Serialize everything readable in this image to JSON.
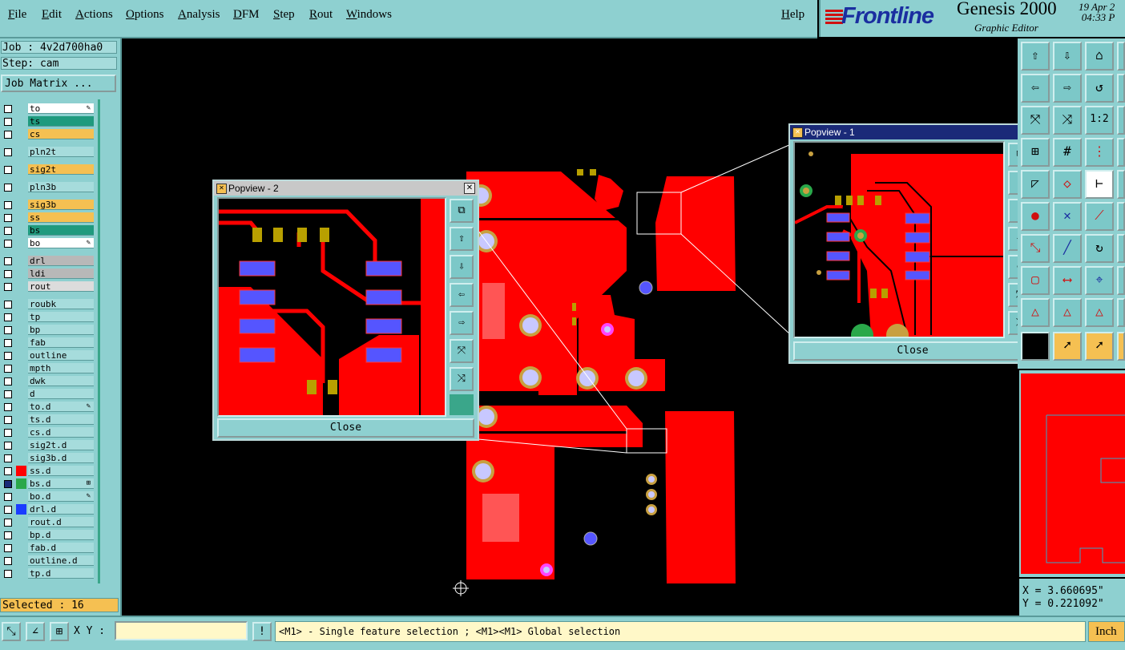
{
  "menu": {
    "items": [
      "File",
      "Edit",
      "Actions",
      "Options",
      "Analysis",
      "DFM",
      "Step",
      "Rout",
      "Windows"
    ],
    "help": "Help"
  },
  "brand": {
    "logo": "Frontline",
    "product": "Genesis 2000",
    "subtitle": "Graphic Editor",
    "date": "19 Apr 2",
    "time": "04:33 P"
  },
  "job": {
    "job_label": "Job : 4v2d700ha0",
    "step_label": "Step: cam",
    "matrix_button": "Job Matrix ..."
  },
  "layers": [
    {
      "name": "to",
      "color": "#ffffff",
      "flag": "✎",
      "checked": false,
      "swatch": ""
    },
    {
      "name": "ts",
      "color": "#1f9a7e",
      "flag": "",
      "checked": false,
      "swatch": ""
    },
    {
      "name": "cs",
      "color": "#f5c052",
      "flag": "",
      "checked": false,
      "swatch": ""
    },
    {
      "name": "pln2t",
      "color": "#a6dcdc",
      "flag": "",
      "checked": false,
      "swatch": ""
    },
    {
      "name": "sig2t",
      "color": "#f5c052",
      "flag": "",
      "checked": false,
      "swatch": ""
    },
    {
      "name": "pln3b",
      "color": "#a6dcdc",
      "flag": "",
      "checked": false,
      "swatch": ""
    },
    {
      "name": "sig3b",
      "color": "#f5c052",
      "flag": "",
      "checked": false,
      "swatch": ""
    },
    {
      "name": "ss",
      "color": "#f5c052",
      "flag": "",
      "checked": false,
      "swatch": ""
    },
    {
      "name": "bs",
      "color": "#1f9a7e",
      "flag": "",
      "checked": false,
      "swatch": ""
    },
    {
      "name": "bo",
      "color": "#ffffff",
      "flag": "✎",
      "checked": false,
      "swatch": ""
    },
    {
      "name": "drl",
      "color": "#b8b8b8",
      "flag": "",
      "checked": false,
      "swatch": ""
    },
    {
      "name": "ldi",
      "color": "#b8b8b8",
      "flag": "",
      "checked": false,
      "swatch": ""
    },
    {
      "name": "rout",
      "color": "#dcdcdc",
      "flag": "",
      "checked": false,
      "swatch": ""
    },
    {
      "name": "roubk",
      "color": "#a6dcdc",
      "flag": "",
      "checked": false,
      "swatch": ""
    },
    {
      "name": "tp",
      "color": "#a6dcdc",
      "flag": "",
      "checked": false,
      "swatch": ""
    },
    {
      "name": "bp",
      "color": "#a6dcdc",
      "flag": "",
      "checked": false,
      "swatch": ""
    },
    {
      "name": "fab",
      "color": "#a6dcdc",
      "flag": "",
      "checked": false,
      "swatch": ""
    },
    {
      "name": "outline",
      "color": "#a6dcdc",
      "flag": "",
      "checked": false,
      "swatch": ""
    },
    {
      "name": "mpth",
      "color": "#a6dcdc",
      "flag": "",
      "checked": false,
      "swatch": ""
    },
    {
      "name": "dwk",
      "color": "#a6dcdc",
      "flag": "",
      "checked": false,
      "swatch": ""
    },
    {
      "name": "d",
      "color": "#a6dcdc",
      "flag": "",
      "checked": false,
      "swatch": ""
    },
    {
      "name": "to.d",
      "color": "#a6dcdc",
      "flag": "✎",
      "checked": false,
      "swatch": ""
    },
    {
      "name": "ts.d",
      "color": "#a6dcdc",
      "flag": "",
      "checked": false,
      "swatch": ""
    },
    {
      "name": "cs.d",
      "color": "#a6dcdc",
      "flag": "",
      "checked": false,
      "swatch": ""
    },
    {
      "name": "sig2t.d",
      "color": "#a6dcdc",
      "flag": "",
      "checked": false,
      "swatch": ""
    },
    {
      "name": "sig3b.d",
      "color": "#a6dcdc",
      "flag": "",
      "checked": false,
      "swatch": ""
    },
    {
      "name": "ss.d",
      "color": "#a6dcdc",
      "flag": "",
      "checked": false,
      "swatch": "#ff0000"
    },
    {
      "name": "bs.d",
      "color": "#a6dcdc",
      "flag": "⊞",
      "checked": true,
      "swatch": "#2aa84a"
    },
    {
      "name": "bo.d",
      "color": "#a6dcdc",
      "flag": "✎",
      "checked": false,
      "swatch": ""
    },
    {
      "name": "drl.d",
      "color": "#a6dcdc",
      "flag": "",
      "checked": false,
      "swatch": "#1a3cff"
    },
    {
      "name": "rout.d",
      "color": "#a6dcdc",
      "flag": "",
      "checked": false,
      "swatch": ""
    },
    {
      "name": "bp.d",
      "color": "#a6dcdc",
      "flag": "",
      "checked": false,
      "swatch": ""
    },
    {
      "name": "fab.d",
      "color": "#a6dcdc",
      "flag": "",
      "checked": false,
      "swatch": ""
    },
    {
      "name": "outline.d",
      "color": "#a6dcdc",
      "flag": "",
      "checked": false,
      "swatch": ""
    },
    {
      "name": "tp.d",
      "color": "#a6dcdc",
      "flag": "",
      "checked": false,
      "swatch": ""
    }
  ],
  "status": {
    "selected": "Selected : 16",
    "xy_label": "X Y :",
    "xy_value": "",
    "message": "<M1> - Single feature selection ; <M1><M1> Global selection",
    "units": "Inch",
    "coord_x": "X = 3.660695\"",
    "coord_y": "Y = 0.221092\""
  },
  "popview1": {
    "title": "Popview - 1",
    "close": "Close"
  },
  "popview2": {
    "title": "Popview - 2",
    "close": "Close"
  },
  "colors": {
    "panel": "#8ed0d0",
    "copper": "#ff0000",
    "pad_blue": "#5555ff",
    "pad_olive": "#b8a000",
    "canvas": "#000000"
  },
  "tools": {
    "zoom_ratio_label": "1:2"
  }
}
